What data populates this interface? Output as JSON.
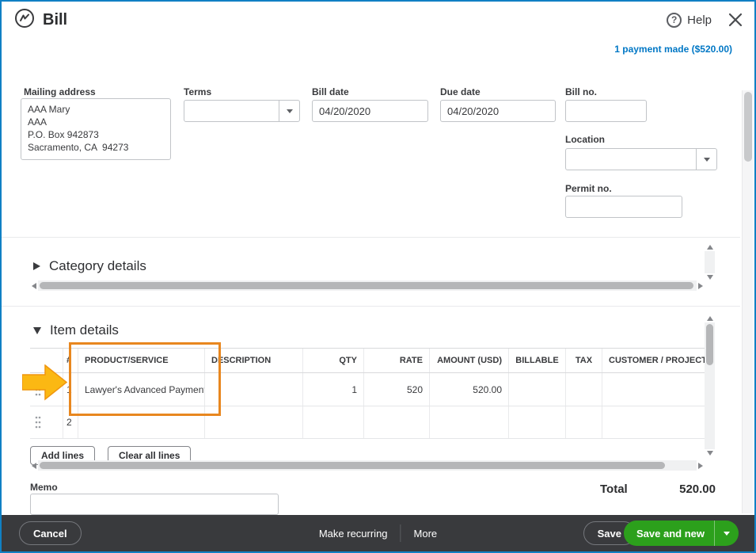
{
  "colors": {
    "window_border_blue": "#1080c4",
    "link_blue": "#0077c5",
    "footer_dark": "#393a3d",
    "accent_green": "#2ca01c",
    "annotation_orange": "#e8871f",
    "arrow_yellow": "#fbb813"
  },
  "header": {
    "title": "Bill",
    "help_label": "Help",
    "payment_link": "1 payment made ($520.00)"
  },
  "form": {
    "mailing_address": {
      "label": "Mailing address",
      "value": "AAA Mary\nAAA\nP.O. Box 942873\nSacramento, CA  94273"
    },
    "terms": {
      "label": "Terms",
      "value": ""
    },
    "bill_date": {
      "label": "Bill date",
      "value": "04/20/2020"
    },
    "due_date": {
      "label": "Due date",
      "value": "04/20/2020"
    },
    "bill_no": {
      "label": "Bill no.",
      "value": ""
    },
    "location": {
      "label": "Location",
      "value": ""
    },
    "permit_no": {
      "label": "Permit no.",
      "value": ""
    }
  },
  "sections": {
    "category_details_title": "Category details",
    "item_details_title": "Item details"
  },
  "item_table": {
    "columns": [
      "#",
      "PRODUCT/SERVICE",
      "DESCRIPTION",
      "QTY",
      "RATE",
      "AMOUNT (USD)",
      "BILLABLE",
      "TAX",
      "CUSTOMER / PROJECT"
    ],
    "rows": [
      {
        "num": "1",
        "product": "Lawyer's Advanced Payment",
        "description": "",
        "qty": "1",
        "rate": "520",
        "amount": "520.00",
        "billable": "",
        "tax": "",
        "customer": ""
      },
      {
        "num": "2",
        "product": "",
        "description": "",
        "qty": "",
        "rate": "",
        "amount": "",
        "billable": "",
        "tax": "",
        "customer": ""
      }
    ],
    "add_lines_label": "Add lines",
    "clear_all_lines_label": "Clear all lines"
  },
  "memo": {
    "label": "Memo",
    "value": ""
  },
  "total": {
    "label": "Total",
    "value": "520.00"
  },
  "footer": {
    "cancel_label": "Cancel",
    "make_recurring_label": "Make recurring",
    "more_label": "More",
    "save_label": "Save",
    "save_and_new_label": "Save and new"
  }
}
